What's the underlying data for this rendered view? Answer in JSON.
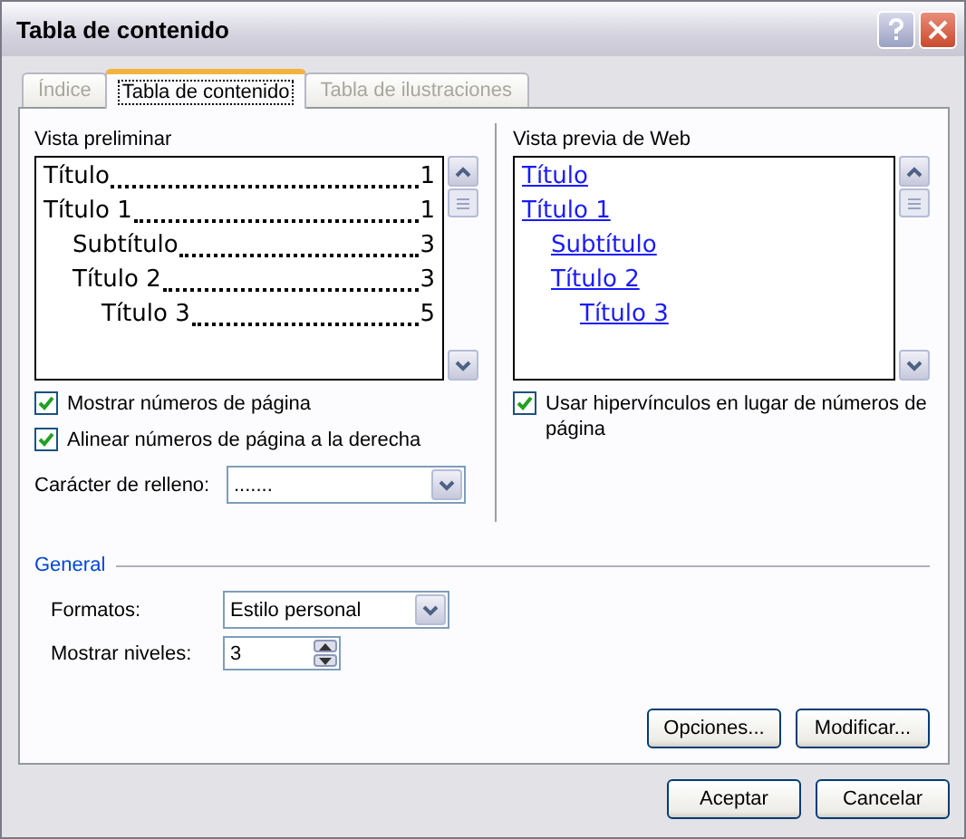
{
  "window": {
    "title": "Tabla de contenido"
  },
  "tabs": [
    {
      "label": "Índice",
      "selected": false,
      "disabled": true
    },
    {
      "label": "Tabla de contenido",
      "selected": true,
      "disabled": false
    },
    {
      "label": "Tabla de ilustraciones",
      "selected": false,
      "disabled": true
    }
  ],
  "print_preview": {
    "label": "Vista preliminar",
    "entries": [
      {
        "text": "Título",
        "page": "1"
      },
      {
        "text": "Título 1",
        "page": "1",
        "children": [
          {
            "text": "Subtítulo",
            "page": "3"
          },
          {
            "text": "Título 2",
            "page": "3",
            "children": [
              {
                "text": "Título 3",
                "page": "5"
              }
            ]
          }
        ]
      }
    ]
  },
  "web_preview": {
    "label": "Vista previa de Web",
    "entries": [
      {
        "text": "Título"
      },
      {
        "text": "Título 1",
        "children": [
          {
            "text": "Subtítulo"
          },
          {
            "text": "Título 2",
            "children": [
              {
                "text": "Título 3"
              }
            ]
          }
        ]
      }
    ]
  },
  "left_options": [
    {
      "label": "Mostrar números de página",
      "checked": true
    },
    {
      "label": "Alinear números de página a la derecha",
      "checked": true
    }
  ],
  "fill_character": {
    "label": "Carácter de relleno:",
    "value": "......."
  },
  "right_options": [
    {
      "label": "Usar hipervínculos en lugar de números de página",
      "checked": true
    }
  ],
  "general": {
    "title": "General",
    "formats": {
      "label": "Formatos:",
      "value": "Estilo personal"
    },
    "levels": {
      "label": "Mostrar niveles:",
      "value": "3"
    }
  },
  "panel_buttons": [
    "Opciones...",
    "Modificar..."
  ],
  "buttons": [
    "Aceptar",
    "Cancelar"
  ]
}
